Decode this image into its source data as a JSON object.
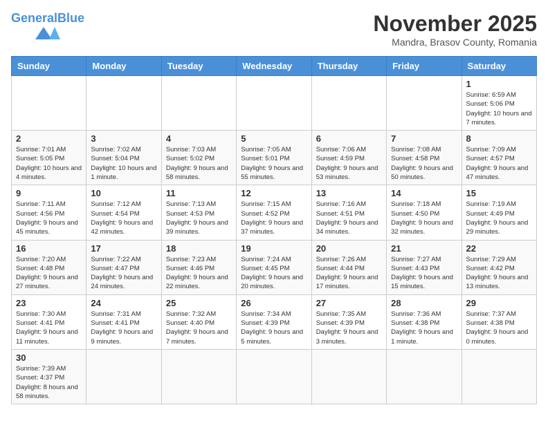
{
  "header": {
    "logo_text_general": "General",
    "logo_text_blue": "Blue",
    "month_title": "November 2025",
    "location": "Mandra, Brasov County, Romania"
  },
  "weekdays": [
    "Sunday",
    "Monday",
    "Tuesday",
    "Wednesday",
    "Thursday",
    "Friday",
    "Saturday"
  ],
  "weeks": [
    [
      {
        "day": "",
        "info": ""
      },
      {
        "day": "",
        "info": ""
      },
      {
        "day": "",
        "info": ""
      },
      {
        "day": "",
        "info": ""
      },
      {
        "day": "",
        "info": ""
      },
      {
        "day": "",
        "info": ""
      },
      {
        "day": "1",
        "info": "Sunrise: 6:59 AM\nSunset: 5:06 PM\nDaylight: 10 hours and 7 minutes."
      }
    ],
    [
      {
        "day": "2",
        "info": "Sunrise: 7:01 AM\nSunset: 5:05 PM\nDaylight: 10 hours and 4 minutes."
      },
      {
        "day": "3",
        "info": "Sunrise: 7:02 AM\nSunset: 5:04 PM\nDaylight: 10 hours and 1 minute."
      },
      {
        "day": "4",
        "info": "Sunrise: 7:03 AM\nSunset: 5:02 PM\nDaylight: 9 hours and 58 minutes."
      },
      {
        "day": "5",
        "info": "Sunrise: 7:05 AM\nSunset: 5:01 PM\nDaylight: 9 hours and 55 minutes."
      },
      {
        "day": "6",
        "info": "Sunrise: 7:06 AM\nSunset: 4:59 PM\nDaylight: 9 hours and 53 minutes."
      },
      {
        "day": "7",
        "info": "Sunrise: 7:08 AM\nSunset: 4:58 PM\nDaylight: 9 hours and 50 minutes."
      },
      {
        "day": "8",
        "info": "Sunrise: 7:09 AM\nSunset: 4:57 PM\nDaylight: 9 hours and 47 minutes."
      }
    ],
    [
      {
        "day": "9",
        "info": "Sunrise: 7:11 AM\nSunset: 4:56 PM\nDaylight: 9 hours and 45 minutes."
      },
      {
        "day": "10",
        "info": "Sunrise: 7:12 AM\nSunset: 4:54 PM\nDaylight: 9 hours and 42 minutes."
      },
      {
        "day": "11",
        "info": "Sunrise: 7:13 AM\nSunset: 4:53 PM\nDaylight: 9 hours and 39 minutes."
      },
      {
        "day": "12",
        "info": "Sunrise: 7:15 AM\nSunset: 4:52 PM\nDaylight: 9 hours and 37 minutes."
      },
      {
        "day": "13",
        "info": "Sunrise: 7:16 AM\nSunset: 4:51 PM\nDaylight: 9 hours and 34 minutes."
      },
      {
        "day": "14",
        "info": "Sunrise: 7:18 AM\nSunset: 4:50 PM\nDaylight: 9 hours and 32 minutes."
      },
      {
        "day": "15",
        "info": "Sunrise: 7:19 AM\nSunset: 4:49 PM\nDaylight: 9 hours and 29 minutes."
      }
    ],
    [
      {
        "day": "16",
        "info": "Sunrise: 7:20 AM\nSunset: 4:48 PM\nDaylight: 9 hours and 27 minutes."
      },
      {
        "day": "17",
        "info": "Sunrise: 7:22 AM\nSunset: 4:47 PM\nDaylight: 9 hours and 24 minutes."
      },
      {
        "day": "18",
        "info": "Sunrise: 7:23 AM\nSunset: 4:46 PM\nDaylight: 9 hours and 22 minutes."
      },
      {
        "day": "19",
        "info": "Sunrise: 7:24 AM\nSunset: 4:45 PM\nDaylight: 9 hours and 20 minutes."
      },
      {
        "day": "20",
        "info": "Sunrise: 7:26 AM\nSunset: 4:44 PM\nDaylight: 9 hours and 17 minutes."
      },
      {
        "day": "21",
        "info": "Sunrise: 7:27 AM\nSunset: 4:43 PM\nDaylight: 9 hours and 15 minutes."
      },
      {
        "day": "22",
        "info": "Sunrise: 7:29 AM\nSunset: 4:42 PM\nDaylight: 9 hours and 13 minutes."
      }
    ],
    [
      {
        "day": "23",
        "info": "Sunrise: 7:30 AM\nSunset: 4:41 PM\nDaylight: 9 hours and 11 minutes."
      },
      {
        "day": "24",
        "info": "Sunrise: 7:31 AM\nSunset: 4:41 PM\nDaylight: 9 hours and 9 minutes."
      },
      {
        "day": "25",
        "info": "Sunrise: 7:32 AM\nSunset: 4:40 PM\nDaylight: 9 hours and 7 minutes."
      },
      {
        "day": "26",
        "info": "Sunrise: 7:34 AM\nSunset: 4:39 PM\nDaylight: 9 hours and 5 minutes."
      },
      {
        "day": "27",
        "info": "Sunrise: 7:35 AM\nSunset: 4:39 PM\nDaylight: 9 hours and 3 minutes."
      },
      {
        "day": "28",
        "info": "Sunrise: 7:36 AM\nSunset: 4:38 PM\nDaylight: 9 hours and 1 minute."
      },
      {
        "day": "29",
        "info": "Sunrise: 7:37 AM\nSunset: 4:38 PM\nDaylight: 9 hours and 0 minutes."
      }
    ],
    [
      {
        "day": "30",
        "info": "Sunrise: 7:39 AM\nSunset: 4:37 PM\nDaylight: 8 hours and 58 minutes."
      },
      {
        "day": "",
        "info": ""
      },
      {
        "day": "",
        "info": ""
      },
      {
        "day": "",
        "info": ""
      },
      {
        "day": "",
        "info": ""
      },
      {
        "day": "",
        "info": ""
      },
      {
        "day": "",
        "info": ""
      }
    ]
  ]
}
